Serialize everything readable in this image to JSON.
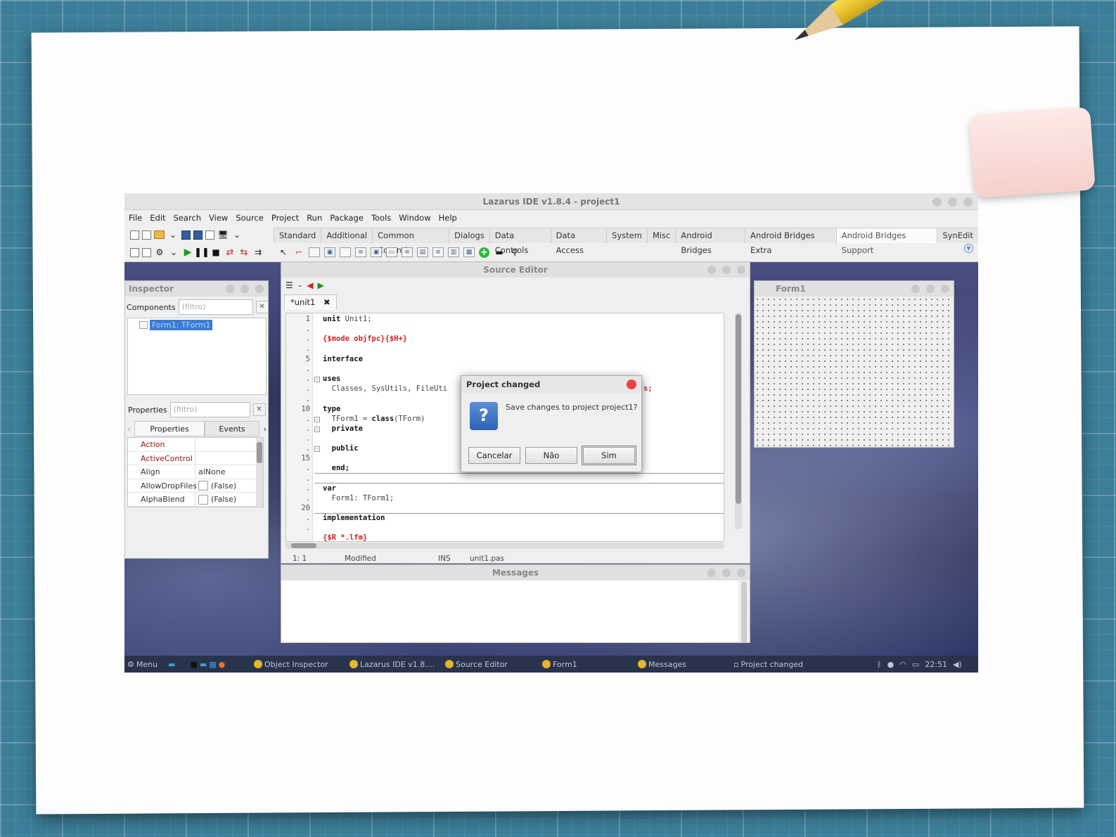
{
  "ide": {
    "title": "Lazarus IDE v1.8.4 - project1",
    "menu": [
      "File",
      "Edit",
      "Search",
      "View",
      "Source",
      "Project",
      "Run",
      "Package",
      "Tools",
      "Window",
      "Help"
    ],
    "palette_tabs": [
      "Standard",
      "Additional",
      "Common Controls",
      "Dialogs",
      "Data Controls",
      "Data Access",
      "System",
      "Misc",
      "Android Bridges",
      "Android Bridges Extra",
      "Android Bridges Support",
      "SynEdit"
    ],
    "active_palette_tab": "Android Bridges Support"
  },
  "inspector": {
    "title": "Inspector",
    "components_label": "Components",
    "components_filter_placeholder": "(filtro)",
    "tree_item": "Form1: TForm1",
    "properties_label": "Properties",
    "properties_filter_placeholder": "(filtro)",
    "tab_properties": "Properties",
    "tab_events": "Events",
    "rows": [
      {
        "name": "Action",
        "value": "",
        "checkbox": false
      },
      {
        "name": "ActiveControl",
        "value": "",
        "checkbox": false
      },
      {
        "name": "Align",
        "value": "alNone",
        "checkbox": false
      },
      {
        "name": "AllowDropFiles",
        "value": "(False)",
        "checkbox": true
      },
      {
        "name": "AlphaBlend",
        "value": "(False)",
        "checkbox": true
      }
    ]
  },
  "editor": {
    "title": "Source Editor",
    "tab": "*unit1",
    "line_numbers": [
      "1",
      "5",
      "10",
      "15",
      "20"
    ],
    "code": {
      "l1_kw": "unit",
      "l1_rest": " Unit1;",
      "l2": "{$mode objfpc}{$H+}",
      "l3": "interface",
      "l4": "uses",
      "l5": "  Classes, SysUtils, FileUti",
      "l5_tail": "s;",
      "l6": "type",
      "l7_a": "  TForm1 = ",
      "l7_kw": "class",
      "l7_b": "(TForm)",
      "l8": "  private",
      "l9": "  public",
      "l10": "  end;",
      "l11": "var",
      "l12": "  Form1: TForm1;",
      "l13": "implementation",
      "l14": "{$R *.lfm}"
    },
    "status": {
      "pos": "1:  1",
      "modified": "Modified",
      "mode": "INS",
      "file": "unit1.pas"
    }
  },
  "messages": {
    "title": "Messages"
  },
  "form1": {
    "title": "Form1"
  },
  "dialog": {
    "title": "Project changed",
    "message": "Save changes to project project1?",
    "cancel": "Cancelar",
    "no": "Não",
    "yes": "Sim"
  },
  "taskbar": {
    "menu": "Menu",
    "tasks": [
      "Object Inspector",
      "Lazarus IDE v1.8....",
      "Source Editor",
      "Form1",
      "Messages",
      "Project changed"
    ],
    "clock": "22:51"
  }
}
